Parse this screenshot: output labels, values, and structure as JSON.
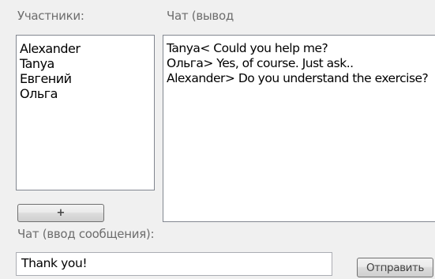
{
  "participants": {
    "label": "Участники:",
    "items": [
      "Alexander",
      "Tanya",
      "Евгений",
      "Ольга"
    ],
    "add_button_label": "+"
  },
  "chat_output": {
    "label": "Чат (вывод",
    "lines": [
      "Tanya< Could you help me?",
      "Ольга> Yes, of course. Just ask..",
      "Alexander> Do you understand the exercise?"
    ]
  },
  "chat_input": {
    "label": "Чат (ввод сообщения):",
    "value": "Thank you!",
    "send_button_label": "Отправить"
  }
}
